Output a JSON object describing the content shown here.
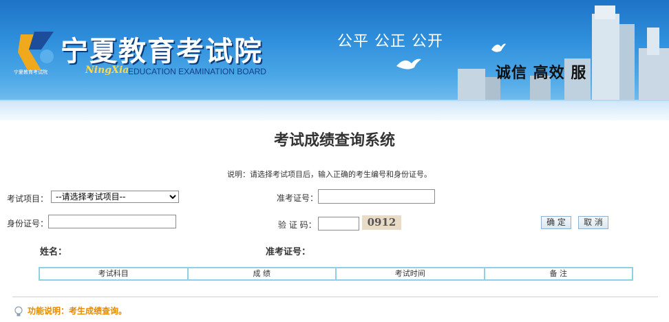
{
  "header": {
    "title_cn": "宁夏教育考试院",
    "brand_script": "NingXia",
    "brand_en": "EDUCATION EXAMINATION BOARD",
    "logo_small_text": "宁夏教育考试院",
    "slogan_top": "公平 公正 公开",
    "slogan_bottom": "诚信 高效 服",
    "colors": {
      "banner": "#2f8fdc",
      "title_shadow": "#0c3a78",
      "script": "#ffd84a"
    }
  },
  "page": {
    "title": "考试成绩查询系统",
    "note": "说明：请选择考试项目后，输入正确的考生编号和身份证号。"
  },
  "form": {
    "exam_item_label": "考试项目：",
    "exam_item_selected": "--请选择考试项目--",
    "admission_label": "准考证号：",
    "admission_value": "",
    "id_label": "身份证号：",
    "id_value": "",
    "captcha_label": "验 证 码：",
    "captcha_value": "",
    "captcha_text": "0912",
    "confirm_label": "确 定",
    "cancel_label": "取 消"
  },
  "result": {
    "name_label": "姓名：",
    "admission_label": "准考证号：",
    "columns": [
      "考试科目",
      "成 绩",
      "考试时间",
      "备 注"
    ]
  },
  "footer": {
    "function_note": "功能说明：考生成绩查询。",
    "icon": "lightbulb-icon"
  }
}
